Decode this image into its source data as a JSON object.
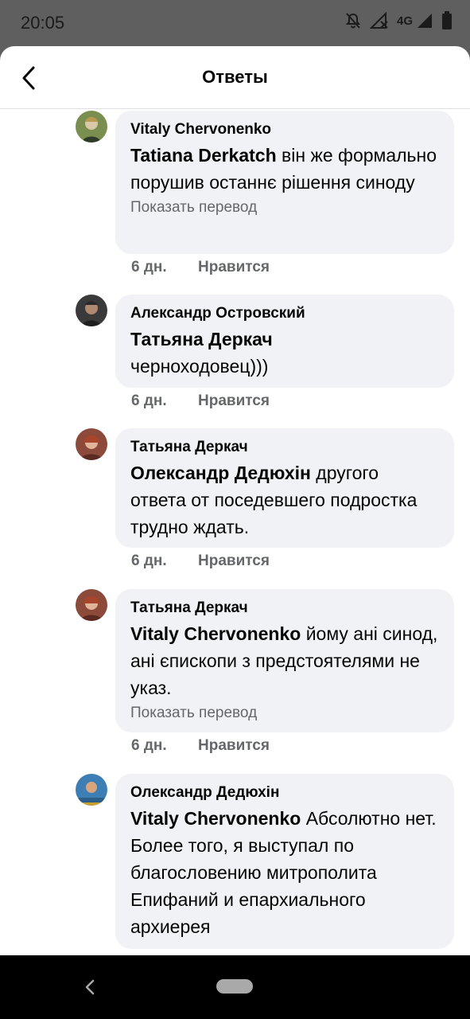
{
  "status_bar": {
    "time": "20:05",
    "network": "4G",
    "icons": [
      "notifications-off-icon",
      "signal-icon",
      "signal-icon",
      "battery-icon"
    ]
  },
  "header": {
    "title": "Ответы",
    "back_icon": "back-arrow-icon"
  },
  "comments": [
    {
      "author": "Vitaly Chervonenko",
      "mention": "Tatiana  Derkatch",
      "text": " він же формально порушив останнє рішення синоду",
      "translate": "Показать перевод",
      "time": "6 дн.",
      "like": "Нравится"
    },
    {
      "author": "Александр Островский",
      "mention": "Татьяна Деркач",
      "text": "черноходовец)))",
      "translate": "",
      "time": "6 дн.",
      "like": "Нравится"
    },
    {
      "author": "Татьяна Деркач",
      "mention": "Олександр Дедюхін",
      "text": " другого ответа от поседевшего подростка трудно ждать.",
      "translate": "",
      "time": "6 дн.",
      "like": "Нравится"
    },
    {
      "author": "Татьяна Деркач",
      "mention": "Vitaly Chervonenko",
      "text": " йому ані синод, ані єпископи з предстоятелями не указ.",
      "translate": "Показать перевод",
      "time": "6 дн.",
      "like": "Нравится"
    },
    {
      "author": "Олександр Дедюхін",
      "mention": "Vitaly Chervonenko",
      "text": " Абсолютно нет. Более того,  я выступал по благословению митрополита Епифаний и епархиального архиерея",
      "translate": "",
      "time": "",
      "like": ""
    }
  ],
  "nav_bar": {
    "back_icon": "nav-back-icon",
    "home_icon": "home-pill-icon"
  }
}
